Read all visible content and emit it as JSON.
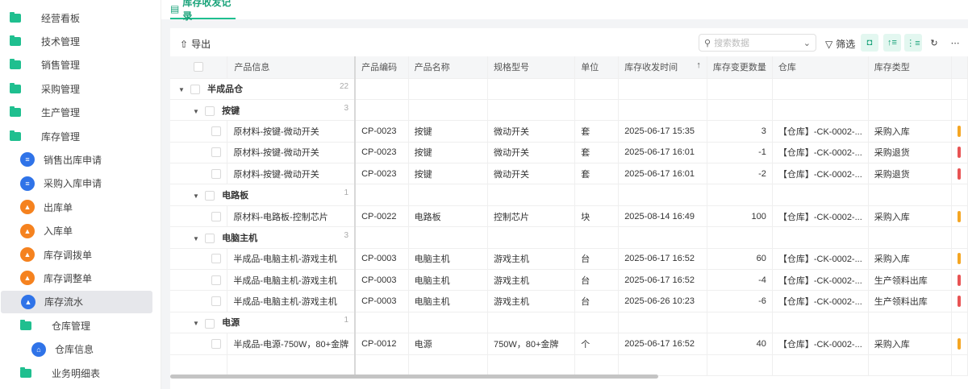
{
  "sidebar": {
    "items": [
      {
        "label": "经营看板",
        "icon": "folder-icon"
      },
      {
        "label": "技术管理",
        "icon": "folder-icon"
      },
      {
        "label": "销售管理",
        "icon": "folder-icon"
      },
      {
        "label": "采购管理",
        "icon": "folder-icon"
      },
      {
        "label": "生产管理",
        "icon": "folder-icon"
      },
      {
        "label": "库存管理",
        "icon": "folder-open-icon"
      },
      {
        "label": "销售出库申请",
        "icon": "document-icon"
      },
      {
        "label": "采购入库申请",
        "icon": "document-icon"
      },
      {
        "label": "出库单",
        "icon": "form-icon"
      },
      {
        "label": "入库单",
        "icon": "form-icon"
      },
      {
        "label": "库存调拨单",
        "icon": "form-icon"
      },
      {
        "label": "库存调整单",
        "icon": "form-icon"
      },
      {
        "label": "库存流水",
        "icon": "form-icon"
      },
      {
        "label": "仓库管理",
        "icon": "folder-open-icon"
      },
      {
        "label": "仓库信息",
        "icon": "home-icon"
      },
      {
        "label": "业务明细表",
        "icon": "folder-icon"
      }
    ]
  },
  "tab": {
    "label": "库存收发记录"
  },
  "toolbar": {
    "export": "导出",
    "search_placeholder": "搜索数据",
    "filter": "筛选"
  },
  "table": {
    "headers": [
      "产品信息",
      "产品编码",
      "产品名称",
      "规格型号",
      "单位",
      "库存收发时间",
      "库存变更数量",
      "仓库",
      "库存类型"
    ],
    "rows": [
      {
        "type": "group",
        "level": 0,
        "label": "半成品仓",
        "count": "22"
      },
      {
        "type": "group",
        "level": 1,
        "label": "按键",
        "count": "3"
      },
      {
        "type": "data",
        "cells": [
          "原材料-按键-微动开关",
          "CP-0023",
          "按键",
          "微动开关",
          "套",
          "2025-06-17 15:35",
          "3",
          "【仓库】-CK-0002-...",
          "采购入库"
        ],
        "tag": "#f5a623"
      },
      {
        "type": "data",
        "cells": [
          "原材料-按键-微动开关",
          "CP-0023",
          "按键",
          "微动开关",
          "套",
          "2025-06-17 16:01",
          "-1",
          "【仓库】-CK-0002-...",
          "采购退货"
        ],
        "tag": "#e85454"
      },
      {
        "type": "data",
        "cells": [
          "原材料-按键-微动开关",
          "CP-0023",
          "按键",
          "微动开关",
          "套",
          "2025-06-17 16:01",
          "-2",
          "【仓库】-CK-0002-...",
          "采购退货"
        ],
        "tag": "#e85454"
      },
      {
        "type": "group",
        "level": 1,
        "label": "电路板",
        "count": "1"
      },
      {
        "type": "data",
        "cells": [
          "原材料-电路板-控制芯片",
          "CP-0022",
          "电路板",
          "控制芯片",
          "块",
          "2025-08-14 16:49",
          "100",
          "【仓库】-CK-0002-...",
          "采购入库"
        ],
        "tag": "#f5a623"
      },
      {
        "type": "group",
        "level": 1,
        "label": "电脑主机",
        "count": "3"
      },
      {
        "type": "data",
        "cells": [
          "半成品-电脑主机-游戏主机",
          "CP-0003",
          "电脑主机",
          "游戏主机",
          "台",
          "2025-06-17 16:52",
          "60",
          "【仓库】-CK-0002-...",
          "采购入库"
        ],
        "tag": "#f5a623"
      },
      {
        "type": "data",
        "cells": [
          "半成品-电脑主机-游戏主机",
          "CP-0003",
          "电脑主机",
          "游戏主机",
          "台",
          "2025-06-17 16:52",
          "-4",
          "【仓库】-CK-0002-...",
          "生产领料出库"
        ],
        "tag": "#e85454"
      },
      {
        "type": "data",
        "cells": [
          "半成品-电脑主机-游戏主机",
          "CP-0003",
          "电脑主机",
          "游戏主机",
          "台",
          "2025-06-26 10:23",
          "-6",
          "【仓库】-CK-0002-...",
          "生产领料出库"
        ],
        "tag": "#e85454"
      },
      {
        "type": "group",
        "level": 1,
        "label": "电源",
        "count": "1"
      },
      {
        "type": "data",
        "cells": [
          "半成品-电源-750W，80+金牌",
          "CP-0012",
          "电源",
          "750W，80+金牌",
          "个",
          "2025-06-17 16:52",
          "40",
          "【仓库】-CK-0002-...",
          "采购入库"
        ],
        "tag": "#f5a623"
      }
    ]
  }
}
